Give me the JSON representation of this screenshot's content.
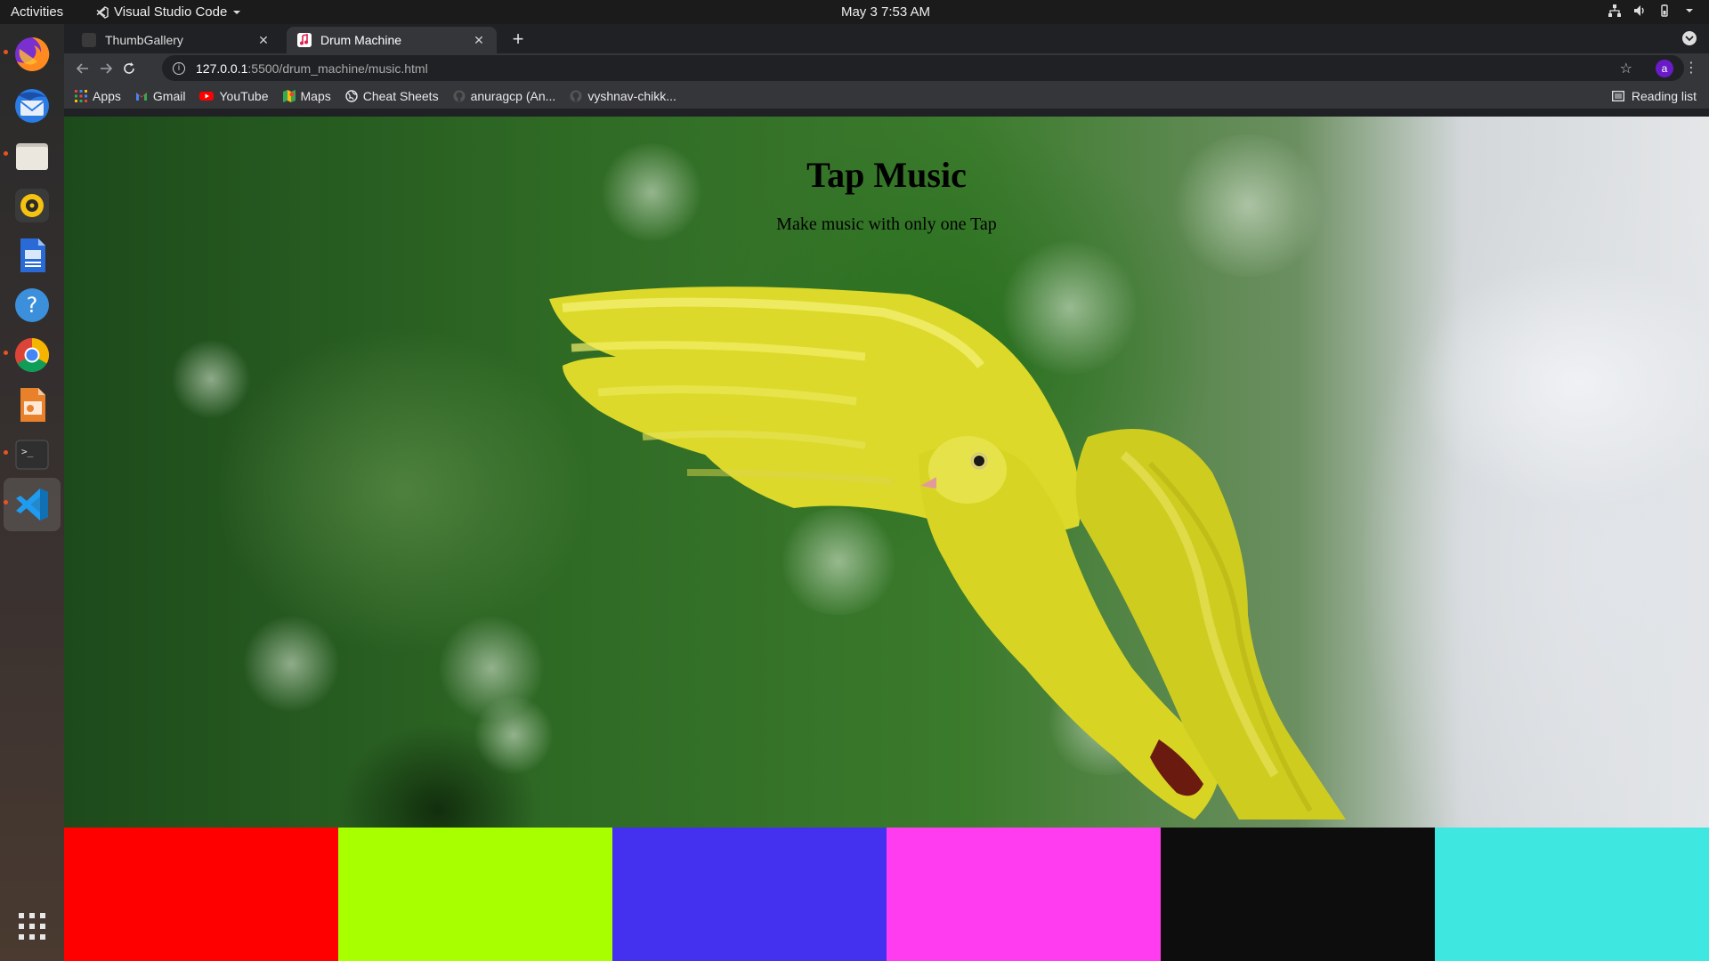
{
  "topbar": {
    "activities": "Activities",
    "app_name": "Visual Studio Code",
    "clock": "May 3  7:53 AM"
  },
  "dock": {
    "items": [
      {
        "name": "firefox-icon",
        "running": true
      },
      {
        "name": "thunderbird-icon",
        "running": false
      },
      {
        "name": "files-icon",
        "running": true
      },
      {
        "name": "rhythmbox-icon",
        "running": false
      },
      {
        "name": "writer-icon",
        "running": false
      },
      {
        "name": "help-icon",
        "running": false
      },
      {
        "name": "chrome-icon",
        "running": true
      },
      {
        "name": "impress-icon",
        "running": false
      },
      {
        "name": "terminal-icon",
        "running": true
      },
      {
        "name": "vscode-icon",
        "running": true
      }
    ]
  },
  "browser": {
    "tabs": [
      {
        "label": "ThumbGallery",
        "active": false
      },
      {
        "label": "Drum Machine",
        "active": true
      }
    ],
    "url_host": "127.0.0.1",
    "url_path": ":5500/drum_machine/music.html",
    "profile_initial": "a",
    "bookmarks": [
      {
        "label": "Apps",
        "icon": "apps-grid-icon"
      },
      {
        "label": "Gmail",
        "icon": "gmail-icon"
      },
      {
        "label": "YouTube",
        "icon": "youtube-icon"
      },
      {
        "label": "Maps",
        "icon": "maps-icon"
      },
      {
        "label": "Cheat Sheets",
        "icon": "globe-icon"
      },
      {
        "label": "anuragcp (An...",
        "icon": "github-icon"
      },
      {
        "label": "vyshnav-chikk...",
        "icon": "github-icon"
      }
    ],
    "reading_list": "Reading list"
  },
  "page": {
    "title": "Tap Music",
    "subtitle": "Make music with only one Tap",
    "pads": [
      {
        "color": "#ff0000"
      },
      {
        "color": "#a8ff00"
      },
      {
        "color": "#4431f0"
      },
      {
        "color": "#ff3cf0"
      },
      {
        "color": "#0d0d0d"
      },
      {
        "color": "#3ee8e0"
      }
    ]
  }
}
